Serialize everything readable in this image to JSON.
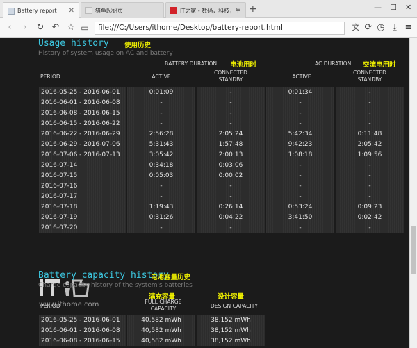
{
  "browser": {
    "tabs": [
      {
        "label": "Battery report",
        "active": true
      },
      {
        "label": "猎鱼起始页",
        "active": false
      },
      {
        "label": "IT之家 - 数码，科技，生",
        "active": false
      }
    ],
    "address": "file:///C:/Users/ithome/Desktop/battery-report.html"
  },
  "usage": {
    "title": "Usage history",
    "title_cn": "使用历史",
    "subtitle": "History of system usage on AC and battery",
    "battery_duration": "BATTERY DURATION",
    "battery_duration_cn": "电池用时",
    "ac_duration": "AC DURATION",
    "ac_duration_cn": "交流电用时",
    "col_period": "PERIOD",
    "col_active": "ACTIVE",
    "col_standby_1": "CONNECTED",
    "col_standby_2": "STANDBY",
    "rows": [
      [
        "2016-05-25 - 2016-06-01",
        "0:01:09",
        "-",
        "0:01:34",
        "-"
      ],
      [
        "2016-06-01 - 2016-06-08",
        "-",
        "-",
        "-",
        "-"
      ],
      [
        "2016-06-08 - 2016-06-15",
        "-",
        "-",
        "-",
        "-"
      ],
      [
        "2016-06-15 - 2016-06-22",
        "-",
        "-",
        "-",
        "-"
      ],
      [
        "2016-06-22 - 2016-06-29",
        "2:56:28",
        "2:05:24",
        "5:42:34",
        "0:11:48"
      ],
      [
        "2016-06-29 - 2016-07-06",
        "5:31:43",
        "1:57:48",
        "9:42:23",
        "2:05:42"
      ],
      [
        "2016-07-06 - 2016-07-13",
        "3:05:42",
        "2:00:13",
        "1:08:18",
        "1:09:56"
      ],
      [
        "2016-07-14",
        "0:34:18",
        "0:03:06",
        "-",
        "-"
      ],
      [
        "2016-07-15",
        "0:05:03",
        "0:00:02",
        "-",
        "-"
      ],
      [
        "2016-07-16",
        "-",
        "-",
        "-",
        "-"
      ],
      [
        "2016-07-17",
        "-",
        "-",
        "-",
        "-"
      ],
      [
        "2016-07-18",
        "1:19:43",
        "0:26:14",
        "0:53:24",
        "0:09:23"
      ],
      [
        "2016-07-19",
        "0:31:26",
        "0:04:22",
        "3:41:50",
        "0:02:42"
      ],
      [
        "2016-07-20",
        "-",
        "-",
        "-",
        "-"
      ]
    ]
  },
  "watermark": {
    "text": "IT之家",
    "url": "www.ithome.com"
  },
  "capacity": {
    "title": "Battery capacity history",
    "title_cn": "电池容量历史",
    "subtitle": "Charge capacity history of the system's batteries",
    "col_period": "PERIOD",
    "col_full_cn": "满充容量",
    "col_full_1": "FULL CHARGE",
    "col_full_2": "CAPACITY",
    "col_design_cn": "设计容量",
    "col_design": "DESIGN CAPACITY",
    "rows": [
      [
        "2016-05-25 - 2016-06-01",
        "40,582 mWh",
        "38,152 mWh"
      ],
      [
        "2016-06-01 - 2016-06-08",
        "40,582 mWh",
        "38,152 mWh"
      ],
      [
        "2016-06-08 - 2016-06-15",
        "40,582 mWh",
        "38,152 mWh"
      ]
    ]
  },
  "colors": {
    "accent": "#3cc7e0",
    "annotation": "#f0f000",
    "background": "#1b1b1b",
    "cell": "#2c2c2c"
  },
  "icons": [
    "back-icon",
    "forward-icon",
    "reload-icon",
    "undo-icon",
    "star-icon",
    "translate-icon",
    "refresh-icon",
    "history-icon",
    "download-icon",
    "menu-icon"
  ]
}
